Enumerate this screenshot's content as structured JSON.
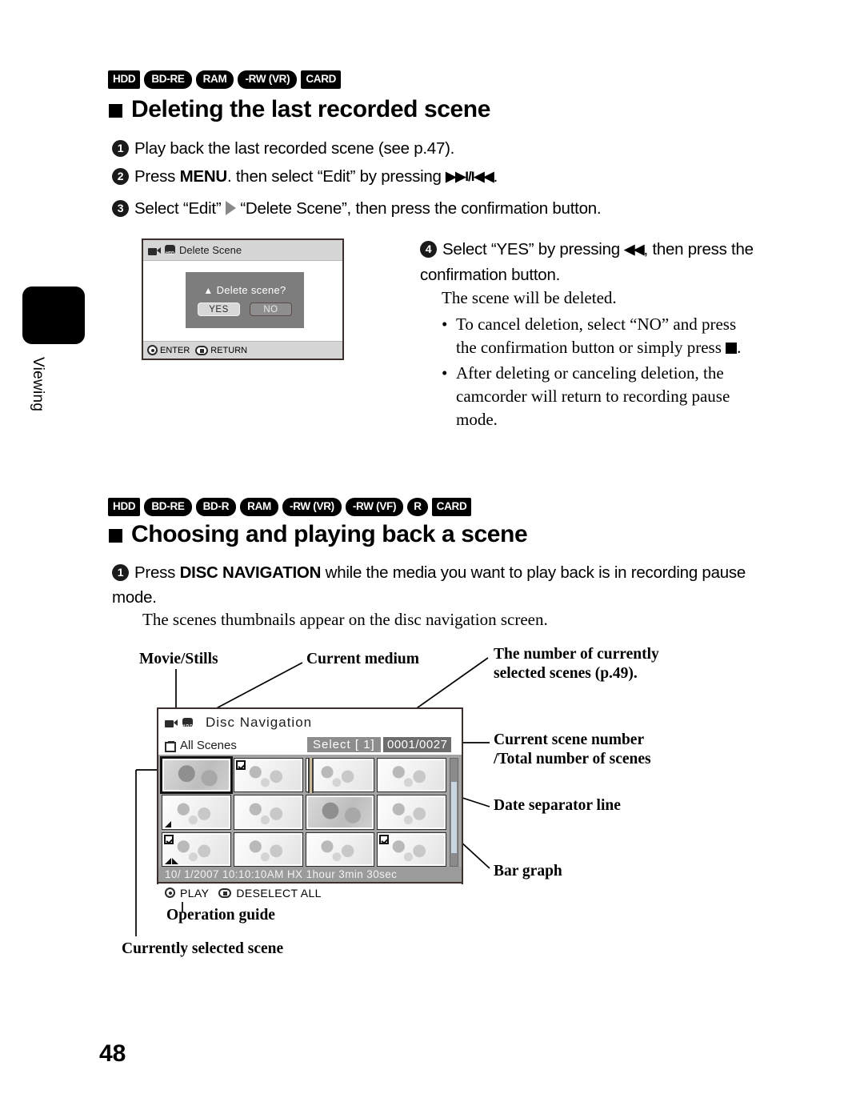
{
  "page": {
    "number": "48",
    "side_tab": "Viewing"
  },
  "section1": {
    "badges": [
      {
        "text": "HDD",
        "shape": "rect"
      },
      {
        "text": "BD-RE",
        "shape": "pill"
      },
      {
        "text": "RAM",
        "shape": "pill"
      },
      {
        "text": "-RW (VR)",
        "shape": "pill"
      },
      {
        "text": "CARD",
        "shape": "rect"
      }
    ],
    "heading": "Deleting the last recorded scene",
    "step1": "Play back the last recorded scene (see p.47).",
    "step2_a": "Press ",
    "step2_b": "MENU",
    "step2_c": ". then select “Edit” by pressing ",
    "step2_glyph": "▶▶I/I◀◀",
    "step2_d": ".",
    "step3_a": "Select “Edit”",
    "step3_b": "“Delete Scene”, then press the confirmation button.",
    "step4_a": "Select “YES” by pressing ",
    "step4_glyph": "◀◀",
    "step4_b": ", then press the confirmation button.",
    "result": "The scene will be deleted.",
    "bullets": [
      "To cancel deletion, select “NO” and press the confirmation button or simply press ",
      "After deleting or canceling deletion, the camcorder will return to recording pause mode."
    ]
  },
  "delete_screen": {
    "title": "Delete  Scene",
    "message": "Delete  scene?",
    "warn_icon": "warning-triangle-icon",
    "yes_label": "YES",
    "no_label": "NO",
    "guide_enter": "ENTER",
    "guide_return": "RETURN"
  },
  "section2": {
    "badges": [
      {
        "text": "HDD",
        "shape": "rect"
      },
      {
        "text": "BD-RE",
        "shape": "pill"
      },
      {
        "text": "BD-R",
        "shape": "pill"
      },
      {
        "text": "RAM",
        "shape": "pill"
      },
      {
        "text": "-RW (VR)",
        "shape": "pill"
      },
      {
        "text": "-RW (VF)",
        "shape": "pill"
      },
      {
        "text": "R",
        "shape": "circle"
      },
      {
        "text": "CARD",
        "shape": "rect"
      }
    ],
    "heading": "Choosing and playing back a scene",
    "step1_a": "Press ",
    "step1_b": "DISC NAVIGATION",
    "step1_c": " while the media you want to play back is in recording pause mode.",
    "note": "The scenes thumbnails appear on the disc navigation screen."
  },
  "disc_nav": {
    "title": "Disc  Navigation",
    "filter": "All Scenes",
    "select_label": "Select [    1]",
    "counter": "0001/0027",
    "datebar": "10/  1/2007   10:10:10AM   HX  1hour 3min 30sec",
    "guide_play": "PLAY",
    "guide_deselect": "DESELECT ALL",
    "thumbnails": [
      {
        "current": true,
        "checked": false,
        "marks": 0,
        "dark": true
      },
      {
        "current": false,
        "checked": true,
        "marks": 0,
        "dark": false
      },
      {
        "current": false,
        "checked": false,
        "marks": 0,
        "dark": false
      },
      {
        "current": false,
        "checked": false,
        "marks": 0,
        "dark": false
      },
      {
        "current": false,
        "checked": false,
        "marks": 1,
        "dark": false
      },
      {
        "current": false,
        "checked": false,
        "marks": 0,
        "dark": false
      },
      {
        "current": false,
        "checked": false,
        "marks": 0,
        "dark": true
      },
      {
        "current": false,
        "checked": false,
        "marks": 0,
        "dark": false
      },
      {
        "current": false,
        "checked": true,
        "marks": 2,
        "dark": false
      },
      {
        "current": false,
        "checked": false,
        "marks": 0,
        "dark": false
      },
      {
        "current": false,
        "checked": false,
        "marks": 0,
        "dark": false
      },
      {
        "current": false,
        "checked": true,
        "marks": 0,
        "dark": false
      }
    ]
  },
  "callouts": {
    "movie_stills": "Movie/Stills",
    "current_medium": "Current medium",
    "selected_count_l1": "The number of currently",
    "selected_count_l2": "selected scenes (p.49).",
    "scene_number_l1": "Current scene number",
    "scene_number_l2": "/Total number of scenes",
    "date_separator": "Date separator line",
    "bar_graph": "Bar graph",
    "operation_guide": "Operation guide",
    "current_scene": "Currently selected scene"
  }
}
